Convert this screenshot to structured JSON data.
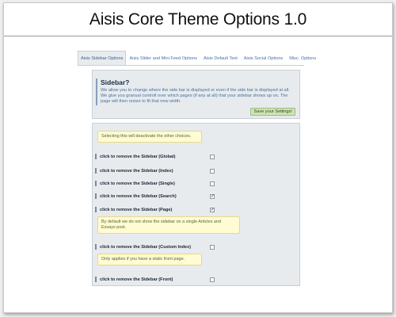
{
  "header": {
    "title": "Aisis Core Theme Options 1.0"
  },
  "tabs": [
    {
      "label": "Aisis Sidebar Options",
      "active": true
    },
    {
      "label": "Aisis Slider and Mini Feed Options",
      "active": false
    },
    {
      "label": "Aisis Default Text",
      "active": false
    },
    {
      "label": "Aisis Social Options",
      "active": false
    },
    {
      "label": "Misc. Options",
      "active": false
    }
  ],
  "intro": {
    "title": "Sidebar?",
    "text": "We allow you to change where the side bar is displayed or even if the side bar is displayed at all. We give you granual controll over which pages (if any at all) that your sidebar shows up on. The page will then resize to fit that new width.",
    "save_label": "Save your Settings!"
  },
  "notes": {
    "deactivate": "Selecting this will deactivate the other choices.",
    "page_default": "By default we do not show the sidebar on a single Articles and Essays post.",
    "static_front": "Only applies if you have a static front page."
  },
  "options": [
    {
      "label": "click to remove the Sidebar (Global)",
      "checked": false
    },
    {
      "label": "click to remove the Sidebar (Index)",
      "checked": false
    },
    {
      "label": "click to remove the Sidebar (Single)",
      "checked": false
    },
    {
      "label": "click to remove the Sidebar (Search)",
      "checked": true
    },
    {
      "label": "click to remove the Sidebar (Page)",
      "checked": true
    },
    {
      "label": "click to remove the Sidebar (Custom Index)",
      "checked": false
    },
    {
      "label": "click to remove the Sidebar (Front)",
      "checked": false
    }
  ],
  "check_glyph": "✓"
}
